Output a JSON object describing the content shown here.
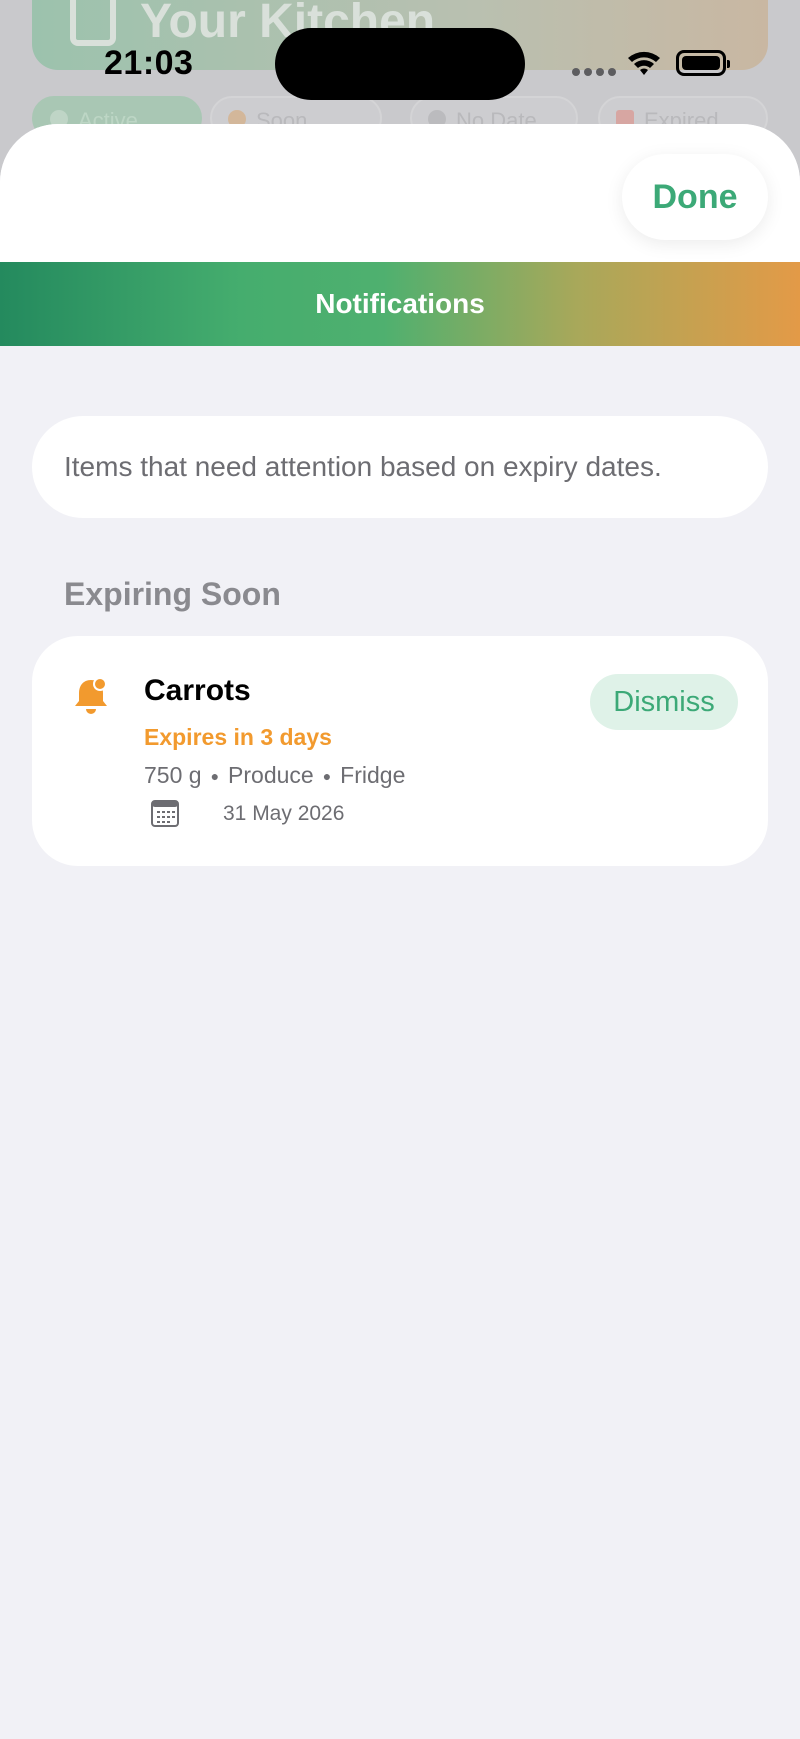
{
  "background_app": {
    "header_title": "Your Kitchen",
    "filters": [
      {
        "label": "Active"
      },
      {
        "label": "Soon"
      },
      {
        "label": "No Date"
      },
      {
        "label": "Expired"
      }
    ]
  },
  "status_bar": {
    "time": "21:03"
  },
  "sheet": {
    "done_label": "Done",
    "nav_title": "Notifications",
    "info_text": "Items that need attention based on expiry dates.",
    "section_title": "Expiring Soon",
    "items": [
      {
        "name": "Carrots",
        "expiry_text": "Expires in 3 days",
        "quantity": "750 g",
        "category": "Produce",
        "location": "Fridge",
        "date": "31 May 2026",
        "dismiss_label": "Dismiss"
      }
    ]
  },
  "colors": {
    "accent_green": "#3ca977",
    "warning_orange": "#f29a2e",
    "sheet_background": "#f1f1f6"
  },
  "icons": {
    "background_header": "fridge-icon",
    "notification": "bell-badge-icon",
    "date": "calendar-icon",
    "wifi": "wifi-icon",
    "battery": "battery-icon"
  }
}
